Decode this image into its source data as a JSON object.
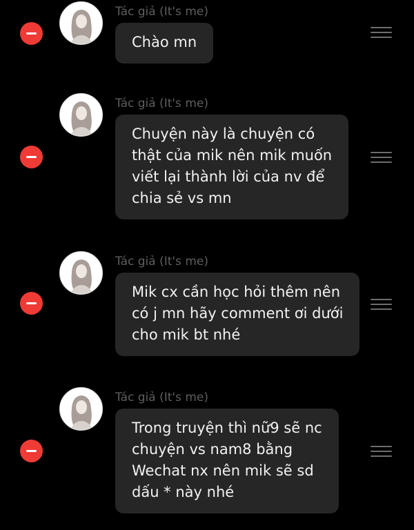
{
  "messages": [
    {
      "author": "Tác giả (It's me)",
      "lines": [
        "Chào mn"
      ]
    },
    {
      "author": "Tác giả (It's me)",
      "lines": [
        "Chuyện này là chuyện có",
        "thật của mik nên mik muốn",
        "viết lại thành lời của nv để",
        "chia sẻ vs mn"
      ]
    },
    {
      "author": "Tác giả (It's me)",
      "lines": [
        "Mik cx cần học hỏi thêm nên",
        "có j mn hãy comment ơi dưới",
        "cho mik bt nhé"
      ]
    },
    {
      "author": "Tác giả (It's me)",
      "lines": [
        "Trong truyện thì nữ9 sẽ nc",
        "chuyện vs nam8 bằng",
        "Wechat nx nên mik sẽ sd",
        "dấu * này nhé"
      ]
    }
  ],
  "icons": {
    "remove": "minus-circle-icon",
    "drag": "drag-handle-icon",
    "avatar": "author-avatar"
  },
  "colors": {
    "background": "#000000",
    "bubble": "#262626",
    "remove_button": "#ef3b36",
    "author_text": "#5e5e5e",
    "message_text": "#f2f2f2",
    "handle": "#6e6e6e"
  }
}
